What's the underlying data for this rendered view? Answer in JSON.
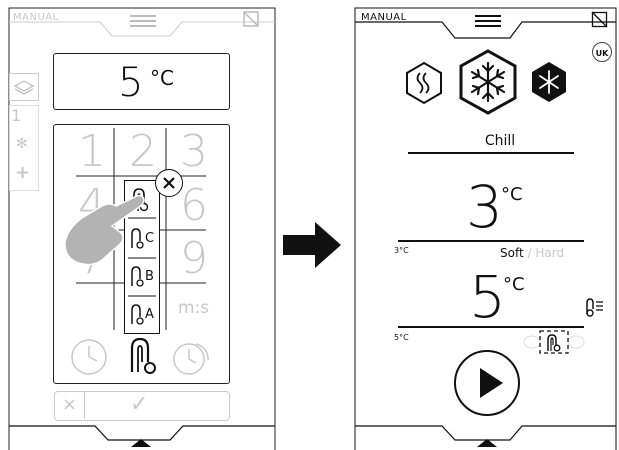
{
  "left_screen": {
    "mode_label": "MANUAL",
    "temperature": {
      "value": "5",
      "unit": "°C"
    },
    "side_tabs": [
      "1",
      "*",
      "+"
    ],
    "keypad": {
      "keys": [
        "1",
        "2",
        "3",
        "4",
        "5",
        "6",
        "7",
        "8",
        "9",
        "m:s"
      ]
    },
    "probe_menu": {
      "items": [
        {
          "label": "",
          "icon": "probe-icon"
        },
        {
          "label": "C",
          "icon": "probe-icon"
        },
        {
          "label": "B",
          "icon": "probe-icon"
        },
        {
          "label": "A",
          "icon": "probe-icon"
        }
      ]
    },
    "footer": {
      "cancel_label": "×",
      "confirm_label": "✓"
    }
  },
  "right_screen": {
    "mode_label": "MANUAL",
    "language_badge": "UK",
    "program": "Chill",
    "air_temperature": {
      "value": "3",
      "unit": "°C",
      "setpoint": "3°C"
    },
    "chill_type": {
      "soft": "Soft",
      "separator": "/",
      "hard": "Hard"
    },
    "core_temperature": {
      "value": "5",
      "unit": "°C",
      "setpoint": "5°C"
    }
  },
  "colors": {
    "line": "#111111",
    "dim": "#c8c8c8",
    "hand": "#b3b3b3"
  }
}
